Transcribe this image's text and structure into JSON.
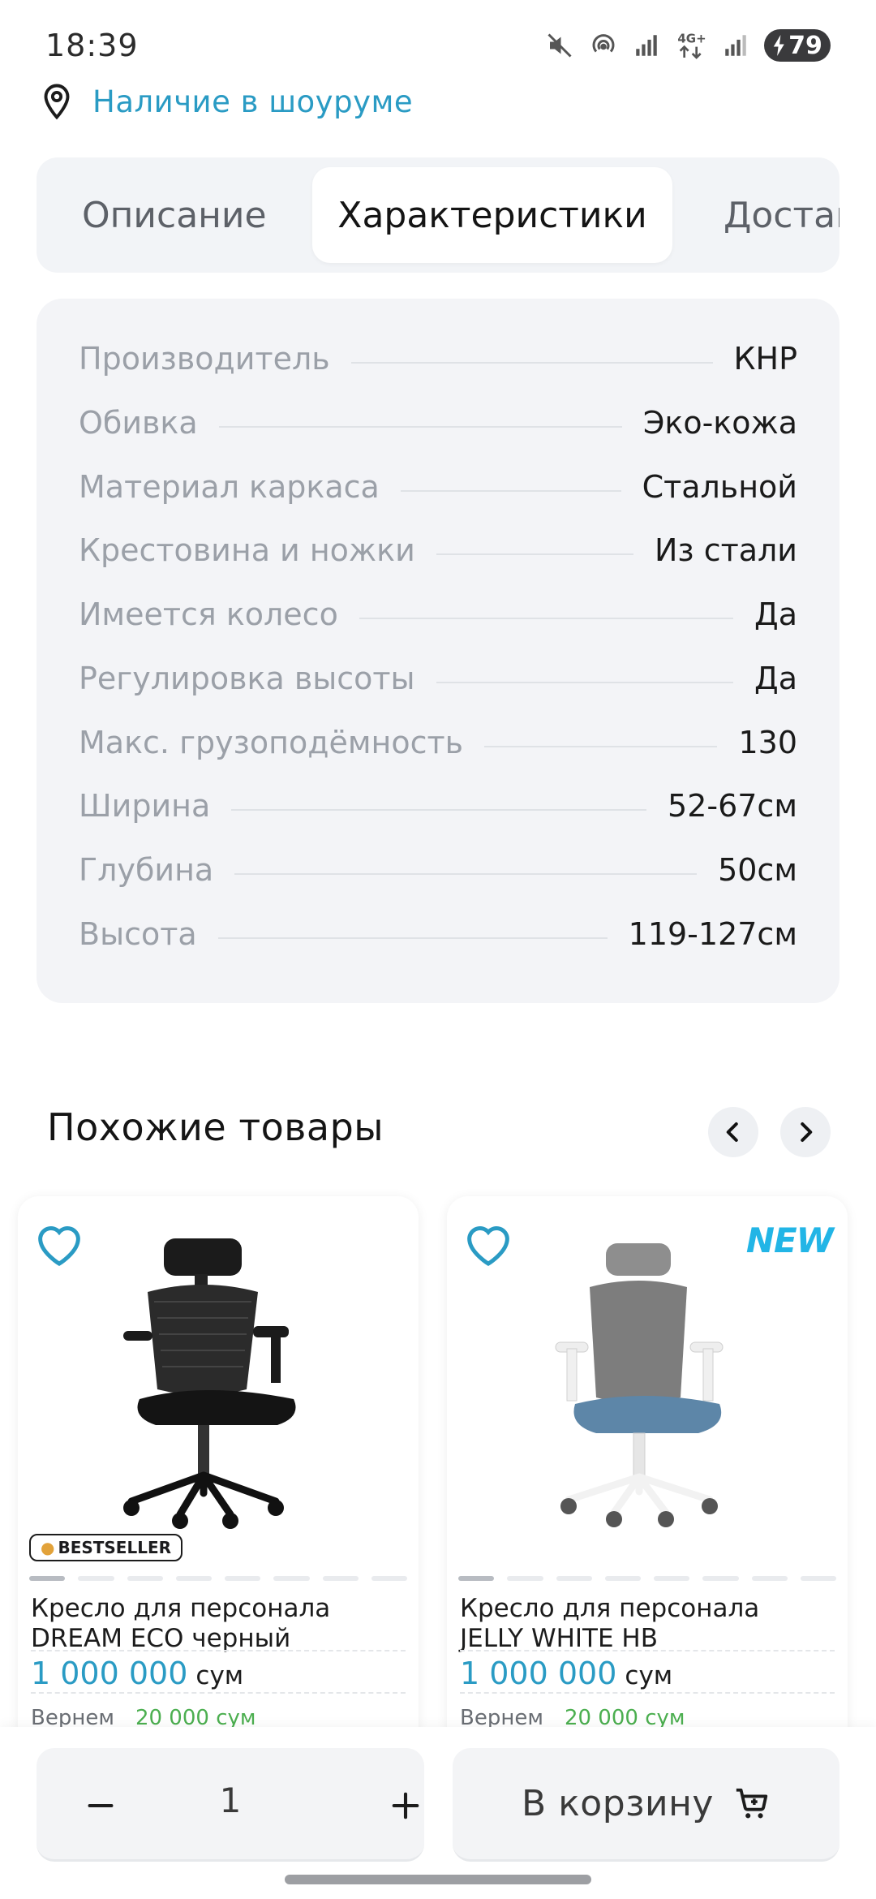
{
  "status_bar": {
    "time": "18:39",
    "battery": "79",
    "network": "4G+",
    "icons": [
      "mute-icon",
      "hotspot-icon",
      "signal-icon",
      "data-icon",
      "signal-icon",
      "battery-icon"
    ]
  },
  "showroom": {
    "label": "Наличие в шоуруме",
    "icon": "location-pin-icon"
  },
  "tabs": [
    {
      "label": "Описание",
      "active": false
    },
    {
      "label": "Характеристики",
      "active": true
    },
    {
      "label": "Доставка",
      "active": false
    }
  ],
  "specs": [
    {
      "label": "Производитель",
      "value": "КНР"
    },
    {
      "label": "Обивка",
      "value": "Эко-кожа"
    },
    {
      "label": "Материал каркаса",
      "value": "Стальной"
    },
    {
      "label": "Крестовина и ножки",
      "value": "Из стали"
    },
    {
      "label": "Имеется колесо",
      "value": "Да"
    },
    {
      "label": "Регулировка высоты",
      "value": "Да"
    },
    {
      "label": "Макс. грузоподёмность",
      "value": "130"
    },
    {
      "label": "Ширина",
      "value": "52-67см"
    },
    {
      "label": "Глубина",
      "value": "50см"
    },
    {
      "label": "Высота",
      "value": "119-127см"
    }
  ],
  "similar": {
    "title": "Похожие товары",
    "products": [
      {
        "name_line1": "Кресло для персонала",
        "name_line2": "DREAM ECO черный",
        "price": "1 000 000",
        "currency": "сум",
        "cashback_label": "Вернем",
        "cashback_value": "20 000 сум",
        "badge": "BESTSELLER",
        "new": "",
        "image_slides": 8,
        "active_slide": 1
      },
      {
        "name_line1": "Кресло для персонала",
        "name_line2": "JELLY WHITE HB",
        "price": "1 000 000",
        "currency": "сум",
        "cashback_label": "Вернем",
        "cashback_value": "20 000 сум",
        "badge": "",
        "new": "NEW",
        "image_slides": 8,
        "active_slide": 1
      }
    ]
  },
  "bottom_bar": {
    "quantity": "1",
    "add_to_cart": "В корзину"
  },
  "colors": {
    "accent": "#2a9bc4",
    "cashback": "#4caf50",
    "new_badge": "#22b5e6"
  }
}
